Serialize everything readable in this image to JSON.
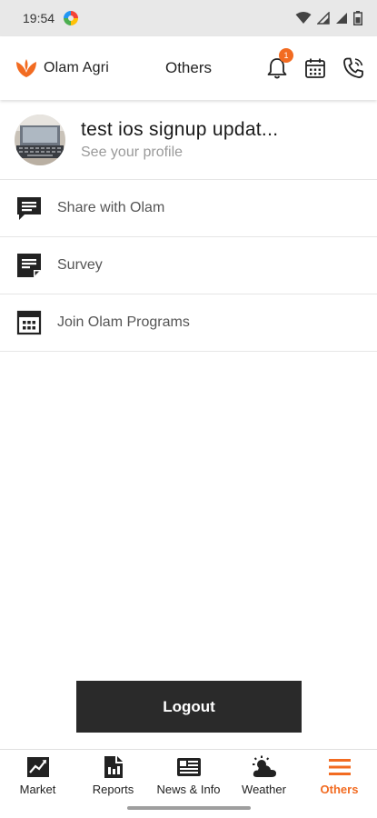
{
  "status_bar": {
    "time": "19:54"
  },
  "header": {
    "brand": "Olam Agri",
    "title": "Others",
    "notification_count": "1",
    "icons": [
      "bell-icon",
      "calendar-icon",
      "phone-icon"
    ]
  },
  "profile": {
    "name": "test ios signup updat...",
    "link": "See your profile"
  },
  "menu": {
    "items": [
      {
        "label": "Share with Olam",
        "icon": "chat-icon"
      },
      {
        "label": "Survey",
        "icon": "survey-icon"
      },
      {
        "label": "Join Olam Programs",
        "icon": "calendar-grid-icon"
      }
    ]
  },
  "logout": {
    "label": "Logout"
  },
  "bottom_nav": {
    "items": [
      {
        "label": "Market",
        "icon": "chart-icon"
      },
      {
        "label": "Reports",
        "icon": "reports-icon"
      },
      {
        "label": "News & Info",
        "icon": "news-icon"
      },
      {
        "label": "Weather",
        "icon": "weather-icon"
      },
      {
        "label": "Others",
        "icon": "menu-icon",
        "active": true
      }
    ]
  },
  "colors": {
    "accent": "#f26b21",
    "dark_button": "#2a2a2a",
    "status_bar": "#e8e8e8"
  }
}
